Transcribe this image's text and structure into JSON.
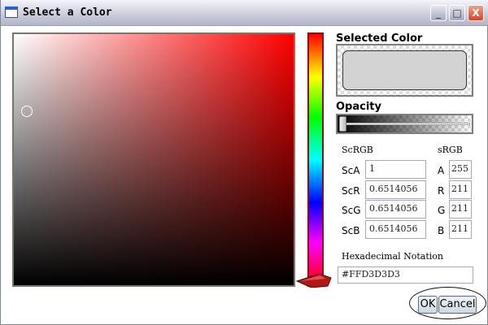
{
  "window": {
    "title": "Select a Color",
    "minimize": "_",
    "maximize": "□",
    "close": "X"
  },
  "selected_color": {
    "label": "Selected Color",
    "value": "#D3D3D3"
  },
  "opacity": {
    "label": "Opacity",
    "value": 1
  },
  "scrgb": {
    "header": "ScRGB",
    "rows": [
      {
        "label": "ScA",
        "value": "1"
      },
      {
        "label": "ScR",
        "value": "0.6514056"
      },
      {
        "label": "ScG",
        "value": "0.6514056"
      },
      {
        "label": "ScB",
        "value": "0.6514056"
      }
    ]
  },
  "srgb": {
    "header": "sRGB",
    "rows": [
      {
        "label": "A",
        "value": "255"
      },
      {
        "label": "R",
        "value": "211"
      },
      {
        "label": "G",
        "value": "211"
      },
      {
        "label": "B",
        "value": "211"
      }
    ]
  },
  "hex": {
    "label": "Hexadecimal Notation",
    "value": "#FFD3D3D3"
  },
  "buttons": {
    "ok": "OK",
    "cancel": "Cancel"
  }
}
